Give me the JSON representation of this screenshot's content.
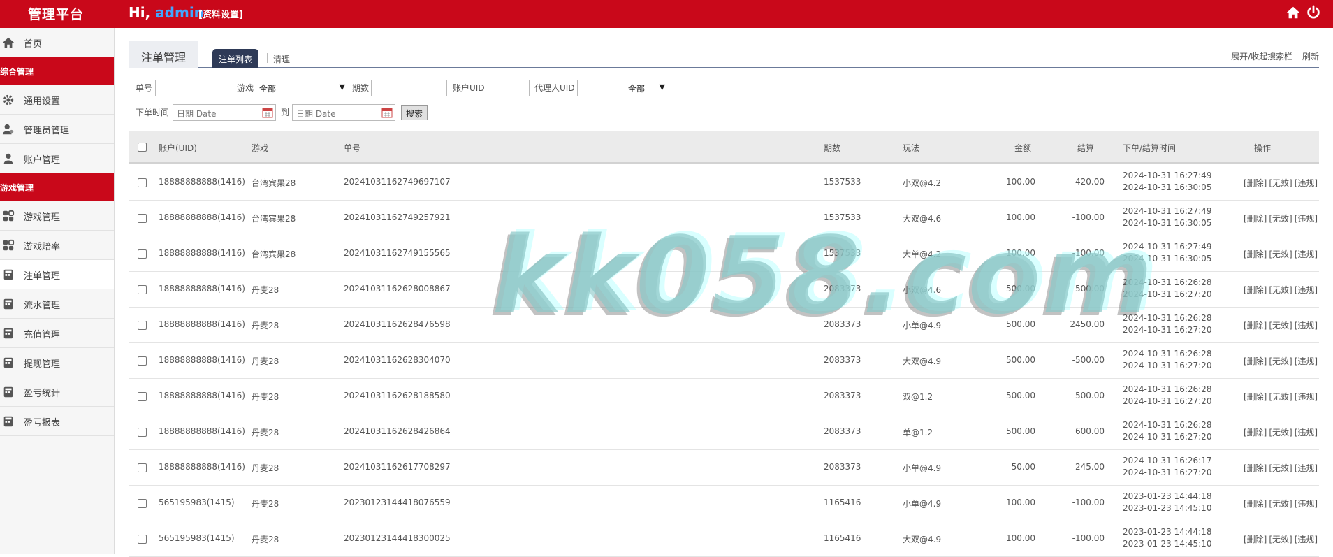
{
  "header": {
    "brand": "管理平台",
    "greeting_prefix": "Hi,",
    "username": "admin",
    "profile_link": "[资料设置]",
    "icons": [
      "home-icon",
      "power-icon"
    ],
    "accent_color": "#c9081a"
  },
  "sidebar": {
    "home": "首页",
    "group1": "综合管理",
    "group1_items": [
      "通用设置",
      "管理员管理",
      "账户管理"
    ],
    "group2": "游戏管理",
    "group2_items": [
      "游戏管理",
      "游戏赔率",
      "注单管理",
      "流水管理",
      "充值管理",
      "提现管理",
      "盈亏统计",
      "盈亏报表"
    ],
    "active_item": "注单管理"
  },
  "page": {
    "title_tab": "注单管理",
    "tab_list": "注单列表",
    "tab_clear": "清理",
    "toggle_search": "展开/收起搜索栏",
    "refresh": "刷新"
  },
  "search": {
    "order_label": "单号",
    "game_label": "游戏",
    "game_selected": "全部",
    "period_label": "期数",
    "account_uid_label": "账户UID",
    "agent_uid_label": "代理人UID",
    "status_selected": "全部",
    "time_label": "下单时间",
    "date_placeholder": "日期 Date",
    "to_label": "到",
    "search_button": "搜索"
  },
  "table": {
    "headers": [
      "账户(UID)",
      "游戏",
      "单号",
      "期数",
      "玩法",
      "金额",
      "结算",
      "下单/结算时间",
      "操作"
    ],
    "actions": [
      "[删除]",
      "[无效]",
      "[违规]"
    ],
    "rows": [
      {
        "account": "18888888888(1416)",
        "game": "台湾宾果28",
        "order": "20241031162749697107",
        "period": "1537533",
        "play": "小双@4.2",
        "amount": "100.00",
        "settle": "420.00",
        "t1": "2024-10-31 16:27:49",
        "t2": "2024-10-31 16:30:05"
      },
      {
        "account": "18888888888(1416)",
        "game": "台湾宾果28",
        "order": "20241031162749257921",
        "period": "1537533",
        "play": "大双@4.6",
        "amount": "100.00",
        "settle": "-100.00",
        "t1": "2024-10-31 16:27:49",
        "t2": "2024-10-31 16:30:05"
      },
      {
        "account": "18888888888(1416)",
        "game": "台湾宾果28",
        "order": "20241031162749155565",
        "period": "1537533",
        "play": "大单@4.2",
        "amount": "100.00",
        "settle": "-100.00",
        "t1": "2024-10-31 16:27:49",
        "t2": "2024-10-31 16:30:05"
      },
      {
        "account": "18888888888(1416)",
        "game": "丹麦28",
        "order": "20241031162628008867",
        "period": "2083373",
        "play": "小双@4.6",
        "amount": "500.00",
        "settle": "-500.00",
        "t1": "2024-10-31 16:26:28",
        "t2": "2024-10-31 16:27:20"
      },
      {
        "account": "18888888888(1416)",
        "game": "丹麦28",
        "order": "20241031162628476598",
        "period": "2083373",
        "play": "小单@4.9",
        "amount": "500.00",
        "settle": "2450.00",
        "t1": "2024-10-31 16:26:28",
        "t2": "2024-10-31 16:27:20"
      },
      {
        "account": "18888888888(1416)",
        "game": "丹麦28",
        "order": "20241031162628304070",
        "period": "2083373",
        "play": "大双@4.9",
        "amount": "500.00",
        "settle": "-500.00",
        "t1": "2024-10-31 16:26:28",
        "t2": "2024-10-31 16:27:20"
      },
      {
        "account": "18888888888(1416)",
        "game": "丹麦28",
        "order": "20241031162628188580",
        "period": "2083373",
        "play": "双@1.2",
        "amount": "500.00",
        "settle": "-500.00",
        "t1": "2024-10-31 16:26:28",
        "t2": "2024-10-31 16:27:20"
      },
      {
        "account": "18888888888(1416)",
        "game": "丹麦28",
        "order": "20241031162628426864",
        "period": "2083373",
        "play": "单@1.2",
        "amount": "500.00",
        "settle": "600.00",
        "t1": "2024-10-31 16:26:28",
        "t2": "2024-10-31 16:27:20"
      },
      {
        "account": "18888888888(1416)",
        "game": "丹麦28",
        "order": "20241031162617708297",
        "period": "2083373",
        "play": "小单@4.9",
        "amount": "50.00",
        "settle": "245.00",
        "t1": "2024-10-31 16:26:17",
        "t2": "2024-10-31 16:27:20"
      },
      {
        "account": "565195983(1415)",
        "game": "丹麦28",
        "order": "20230123144418076559",
        "period": "1165416",
        "play": "小单@4.9",
        "amount": "100.00",
        "settle": "-100.00",
        "t1": "2023-01-23 14:44:18",
        "t2": "2023-01-23 14:45:10"
      },
      {
        "account": "565195983(1415)",
        "game": "丹麦28",
        "order": "20230123144418300025",
        "period": "1165416",
        "play": "大双@4.9",
        "amount": "100.00",
        "settle": "-100.00",
        "t1": "2023-01-23 14:44:18",
        "t2": "2023-01-23 14:45:10"
      }
    ]
  },
  "watermark": "kk058.com"
}
